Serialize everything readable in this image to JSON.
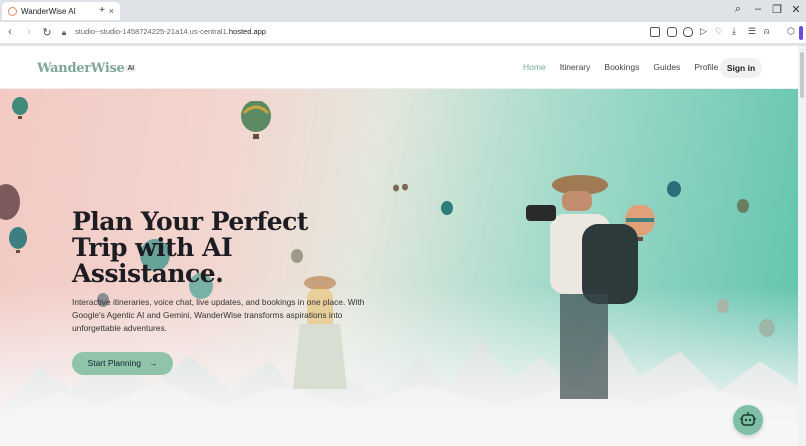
{
  "browser": {
    "tab_title": "WanderWise AI",
    "tab_close": "×",
    "new_tab": "+",
    "url_prefix": "studio--studio-1458724225-21a14.us-central1.",
    "url_host": "hosted.app"
  },
  "site": {
    "brand": "WanderWise",
    "brand_ai": "AI",
    "nav": [
      "Home",
      "Itinerary",
      "Bookings",
      "Guides",
      "Profile"
    ],
    "signin": "Sign in"
  },
  "hero": {
    "headline_1": "Plan Your Perfect",
    "headline_2": "Trip with AI",
    "headline_3": "Assistance.",
    "subtitle": "Interactive itineraries, voice chat, live updates, and bookings in one place. With Google's Agentic AI and Gemini, WanderWise transforms aspirations into unforgettable adventures.",
    "cta": "Start Planning",
    "cta_arrow": "→"
  },
  "colors": {
    "brand": "#7ea898",
    "accent": "#8fc4a8",
    "nav_active": "#6fae98"
  }
}
